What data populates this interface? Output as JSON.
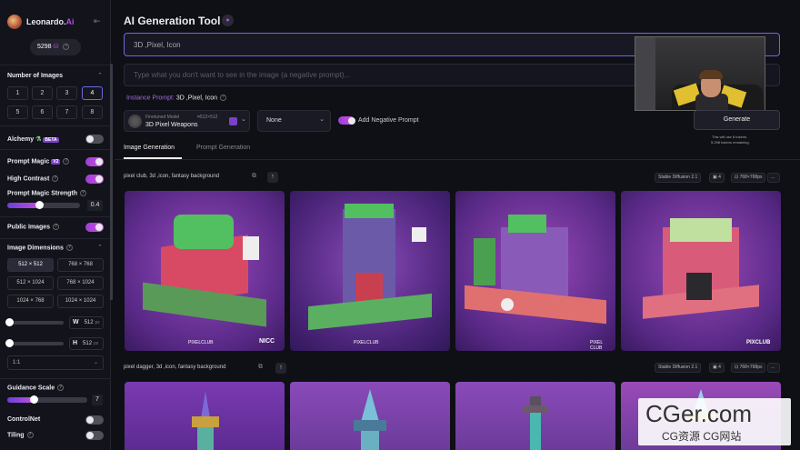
{
  "sidebar": {
    "brand": "Leonardo.",
    "brand_accent": "Ai",
    "tokens": "5298",
    "number_of_images_label": "Number of Images",
    "image_counts": [
      "1",
      "2",
      "3",
      "4",
      "5",
      "6",
      "7",
      "8"
    ],
    "alchemy_label": "Alchemy",
    "beta_badge": "BETA",
    "prompt_magic_label": "Prompt Magic",
    "prompt_magic_version": "V2",
    "high_contrast_label": "High Contrast",
    "prompt_magic_strength_label": "Prompt Magic Strength",
    "prompt_magic_strength_value": "0.4",
    "public_images_label": "Public Images",
    "image_dimensions_label": "Image Dimensions",
    "dimensions": [
      "512 × 512",
      "768 × 768",
      "512 × 1024",
      "768 × 1024",
      "1024 × 768",
      "1024 × 1024"
    ],
    "width_label": "W",
    "width_value": "512",
    "height_label": "H",
    "height_value": "512",
    "px_unit": "px",
    "aspect_ratio": "1:1",
    "guidance_scale_label": "Guidance Scale",
    "guidance_scale_value": "7",
    "controlnet_label": "ControlNet",
    "tiling_label": "Tiling"
  },
  "header": {
    "title": "AI Generation Tool"
  },
  "prompt": {
    "value": "3D ,Pixel, Icon",
    "negative_placeholder": "Type what you don't want to see in the image (a negative prompt)..."
  },
  "instance_prompt": {
    "label": "Instance Prompt:",
    "value": "3D ,Pixel, Icon"
  },
  "model": {
    "tag": "Finetuned Model",
    "size": "512×512",
    "name": "3D Pixel Weapons"
  },
  "style_select": "None",
  "negative_prompt_toggle_label": "Add Negative Prompt",
  "generate": {
    "label": "Generate",
    "note1": "This will use 8 tokens.",
    "note2": "5,298 tokens remaining."
  },
  "tabs": [
    "Image Generation",
    "Prompt Generation"
  ],
  "generations": [
    {
      "prompt": "pixel club, 3d ,icon, fantasy background",
      "chips": [
        "Stable Diffusion 2.1",
        "4",
        "768×768px",
        "..."
      ],
      "captions": [
        "PIXELCLUB",
        "NICC",
        "PIXELCLUB",
        "PIXEL CLUB",
        "PIXCLUB"
      ]
    },
    {
      "prompt": "pixel dagger, 3d ,icon, fantasy background",
      "chips": [
        "Stable Diffusion 2.1",
        "4",
        "768×768px",
        "..."
      ]
    }
  ],
  "watermark": {
    "line1": "CGer.com",
    "line2": "CG资源 CG网站"
  },
  "colors": {
    "accent_purple": "#b44fe0",
    "toggle_on": "#a040d8",
    "selected_outline": "#6a6adf"
  }
}
